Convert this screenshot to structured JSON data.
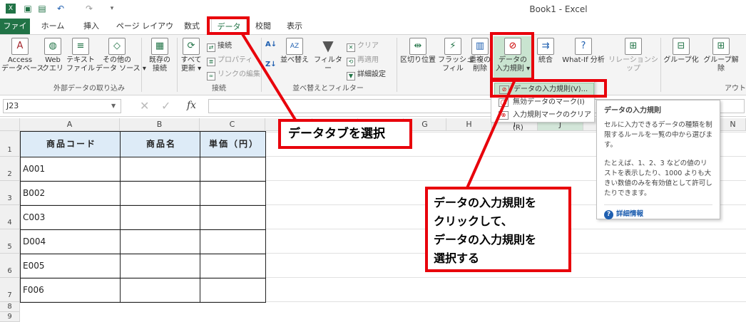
{
  "title_bar": {
    "window_title": "Book1 - Excel",
    "qat_icons": [
      "excel-logo-icon",
      "save-icon",
      "save-as-icon",
      "undo-icon",
      "redo-icon",
      "customize-qat-icon"
    ]
  },
  "menu": {
    "tabs": [
      "ファイル",
      "ホーム",
      "挿入",
      "ページ レイアウト",
      "数式",
      "データ",
      "校閲",
      "表示"
    ]
  },
  "ribbon": {
    "external": {
      "access": "Access\nデータベース",
      "web": "Web\nクエリ",
      "text": "テキスト\nファイル",
      "other": "その他の\nデータ ソース ▾",
      "existing": "既存の\n接続",
      "group": "外部データの取り込み"
    },
    "connections": {
      "refresh": "すべて\n更新 ▾",
      "connections": "接続",
      "properties": "プロパティ",
      "edit_links": "リンクの編集",
      "group": "接続"
    },
    "sort": {
      "sort": "並べ替え",
      "filter": "フィルター",
      "clear": "クリア",
      "reapply": "再適用",
      "advanced": "詳細設定",
      "group": "並べ替えとフィルター"
    },
    "tools": {
      "text_to_cols": "区切り位置",
      "flash_fill": "フラッシュ\nフィル",
      "remove_dup": "重複の\n削除",
      "validation": "データの\n入力規則 ▾",
      "consolidate": "統合",
      "whatif": "What-If 分析",
      "relations": "リレーションシップ"
    },
    "outline": {
      "group_btn": "グループ化",
      "ungroup": "グループ解除",
      "group": "アウト"
    }
  },
  "dropdown": {
    "items": [
      "データの入力規則(V)...",
      "無効データのマーク(I)",
      "入力規則マークのクリア(R)"
    ]
  },
  "tooltip": {
    "title": "データの入力規則",
    "body1": "セルに入力できるデータの種類を制限するルールを一覧の中から選びます。",
    "body2": "たとえば、1、2、3 などの値のリストを表示したり、1000 よりも大きい数値のみを有効値として許可したりできます。",
    "more": "詳細情報"
  },
  "formula_bar": {
    "name_box": "J23",
    "fx": "fx"
  },
  "columns": [
    "A",
    "B",
    "C",
    "D",
    "E",
    "F",
    "G",
    "H",
    "I",
    "J",
    "K",
    "L",
    "M",
    "N"
  ],
  "rows": [
    "1",
    "2",
    "3",
    "4",
    "5",
    "6",
    "7",
    "8",
    "9"
  ],
  "table": {
    "headers": [
      "商品コード",
      "商品名",
      "単価（円）"
    ],
    "codes": [
      "A001",
      "B002",
      "C003",
      "D004",
      "E005",
      "F006"
    ]
  },
  "callouts": {
    "tab": "データタブを選択",
    "validation": "データの入力規則を\nクリックして、\nデータの入力規則を\n選択する"
  }
}
